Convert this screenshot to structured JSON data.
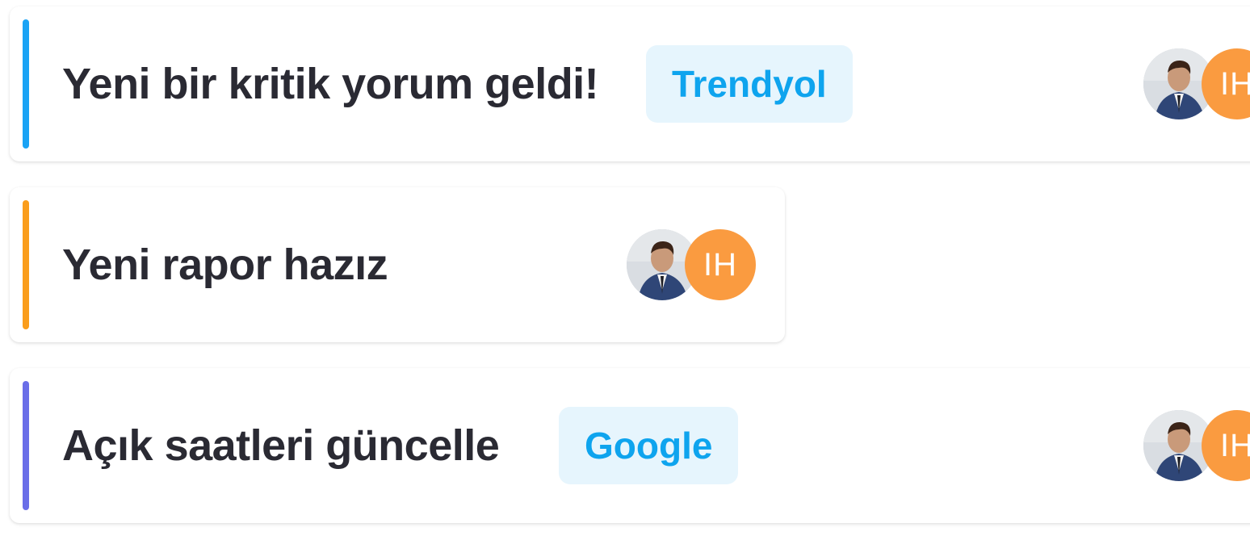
{
  "cards": [
    {
      "title": "Yeni bir kritik yorum geldi!",
      "tag": "Trendyol",
      "accent_color": "#1aa3f5",
      "assignee_initials": "IH",
      "assignee_photo_icon": "user-photo-avatar"
    },
    {
      "title": "Yeni rapor hazız",
      "tag": null,
      "accent_color": "#fa9d1c",
      "assignee_initials": "IH",
      "assignee_photo_icon": "user-photo-avatar"
    },
    {
      "title": "Açık saatleri güncelle",
      "tag": "Google",
      "accent_color": "#6a6ee8",
      "assignee_initials": "IH",
      "assignee_photo_icon": "user-photo-avatar"
    }
  ],
  "colors": {
    "tag_bg": "#e6f5fd",
    "tag_text": "#0ea4ee",
    "initials_bg": "#fa9b40",
    "title_text": "#2a2a33"
  }
}
